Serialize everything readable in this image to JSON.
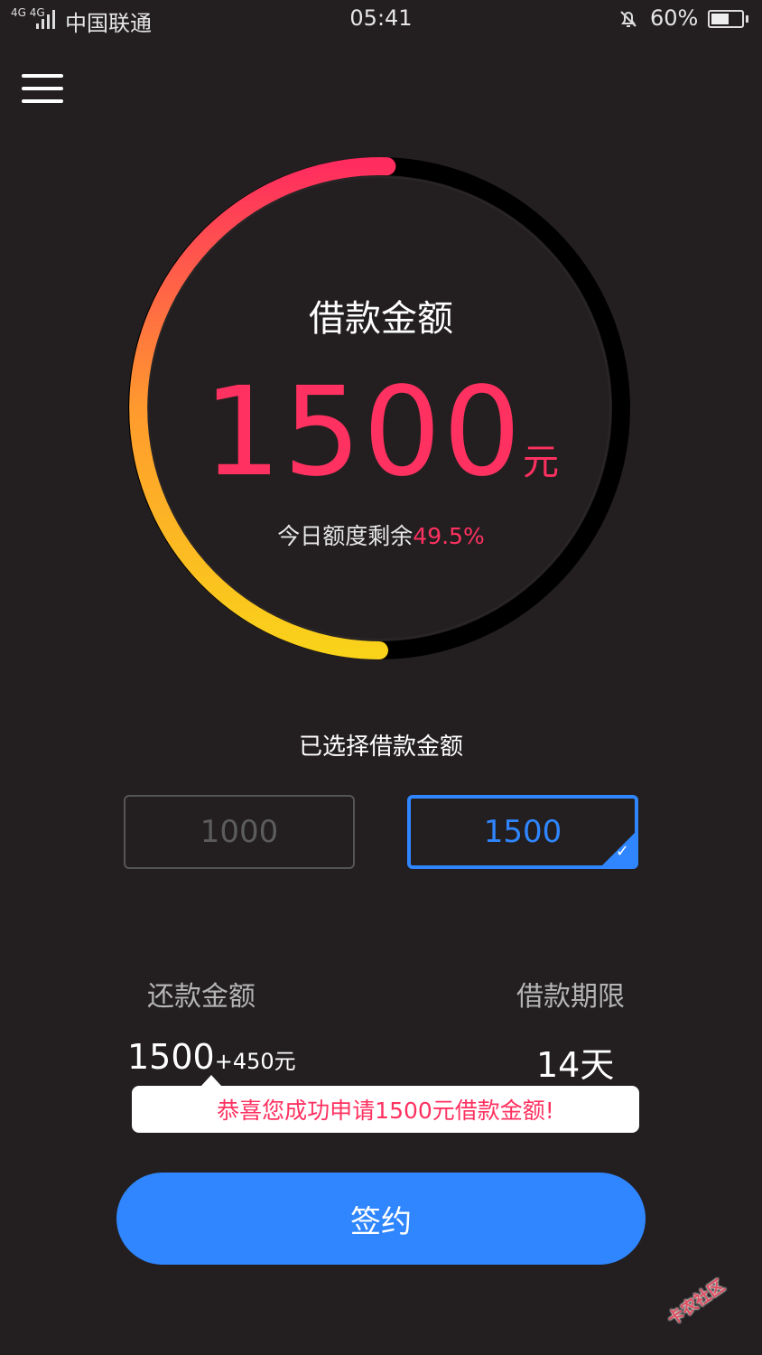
{
  "status_bar": {
    "network": "4G 4G",
    "carrier": "中国联通",
    "time": "05:41",
    "battery": "60%",
    "battery_level": 0.6
  },
  "icons": {
    "menu": "hamburger-menu-icon",
    "bell": "bell-muted-icon",
    "check": "check-icon"
  },
  "gauge": {
    "title": "借款金额",
    "amount": "1500",
    "unit": "元",
    "remaining_label": "今日额度剩余",
    "remaining_pct": "49.5%",
    "filled_fraction": 0.505,
    "colors": {
      "start": "#f9d21a",
      "mid": "#ff9a2e",
      "end": "#ff2d5f",
      "track": "#000000",
      "accent": "#ff3160"
    }
  },
  "selection": {
    "title": "已选择借款金额",
    "options": [
      {
        "label": "1000",
        "selected": false
      },
      {
        "label": "1500",
        "selected": true
      }
    ],
    "accent": "#2f86ff"
  },
  "summary": {
    "repay_label": "还款金额",
    "repay_principal": "1500",
    "repay_extra": "+450元",
    "term_label": "借款期限",
    "term_value": "14天"
  },
  "toast": {
    "message": "恭喜您成功申请1500元借款金额!"
  },
  "action": {
    "sign_label": "签约"
  },
  "watermark": {
    "text": "卡农社区"
  }
}
